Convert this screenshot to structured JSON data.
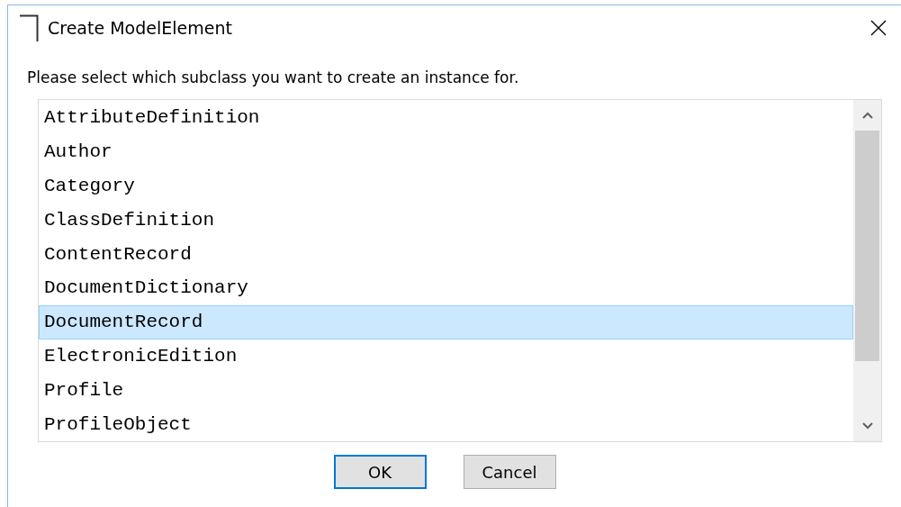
{
  "window": {
    "title": "Create ModelElement"
  },
  "instruction": "Please select which subclass you want to create an instance for.",
  "list": {
    "items": [
      {
        "label": "AttributeDefinition",
        "selected": false
      },
      {
        "label": "Author",
        "selected": false
      },
      {
        "label": "Category",
        "selected": false
      },
      {
        "label": "ClassDefinition",
        "selected": false
      },
      {
        "label": "ContentRecord",
        "selected": false
      },
      {
        "label": "DocumentDictionary",
        "selected": false
      },
      {
        "label": "DocumentRecord",
        "selected": true
      },
      {
        "label": "ElectronicEdition",
        "selected": false
      },
      {
        "label": "Profile",
        "selected": false
      },
      {
        "label": "ProfileObject",
        "selected": false
      }
    ]
  },
  "buttons": [
    {
      "label": "OK",
      "default": true
    },
    {
      "label": "Cancel",
      "default": false
    }
  ]
}
